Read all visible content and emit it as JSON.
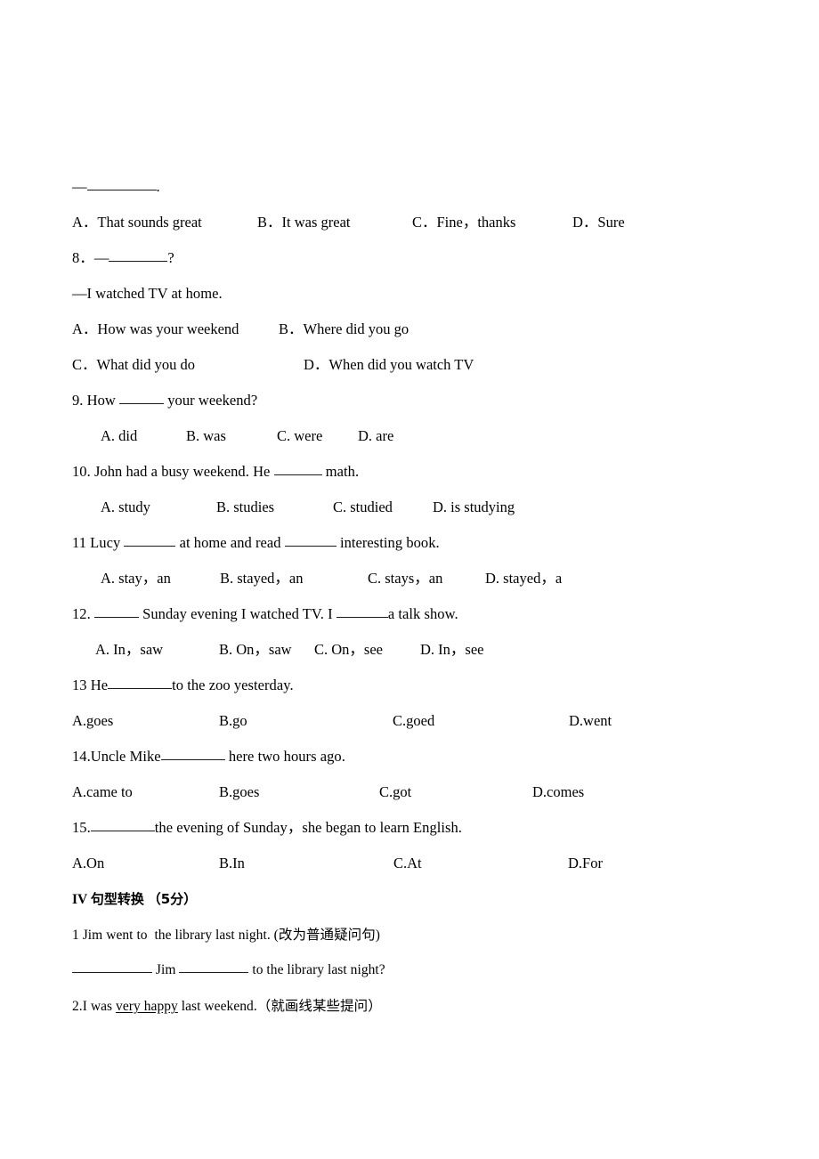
{
  "document": {
    "type": "exam-paper",
    "language": "English / Chinese",
    "page_background": "#ffffff",
    "text_color": "#000000"
  },
  "content": {
    "q7_answer_stem": {
      "dash": "—",
      "trailing": "."
    },
    "q7_options": {
      "a": "A．That sounds great",
      "b": "B．It was great",
      "c": "C．Fine，thanks",
      "d": "D．Sure"
    },
    "q8": {
      "number": "8．",
      "dash": "—",
      "trailing": "?",
      "reply": "—I watched TV at home.",
      "a": "A．How was your weekend",
      "b": "B．Where did you go",
      "c": "C．What did you do",
      "d": "D．When did you watch TV"
    },
    "q9": {
      "stem_before": "9. How ",
      "stem_after": " your weekend?",
      "a": "A. did",
      "b": "B. was",
      "c": "C. were",
      "d": "D. are"
    },
    "q10": {
      "stem_before": "10. John had a busy weekend. He ",
      "stem_after": " math.",
      "a": "A. study",
      "b": "B. studies",
      "c": "C. studied",
      "d": "D. is studying"
    },
    "q11": {
      "stem_before": "11 Lucy ",
      "stem_middle": " at home and read ",
      "stem_after": " interesting book.",
      "a": "A. stay，an",
      "b": "B. stayed，an",
      "c": "C. stays，an",
      "d": "D. stayed，a"
    },
    "q12": {
      "stem_before": "12. ",
      "stem_middle": " Sunday evening I watched TV. I ",
      "stem_after": "a talk show.",
      "a": "A. In，saw",
      "b": "B. On，saw",
      "c": "C. On，see",
      "d": "D. In，see"
    },
    "q13": {
      "stem_before": "13 He",
      "stem_after": "to the zoo yesterday.",
      "a": "A.goes",
      "b": "B.go",
      "c": "C.goed",
      "d": "D.went"
    },
    "q14": {
      "stem_before": "14.Uncle Mike",
      "stem_after": " here two hours ago.",
      "a": "A.came to",
      "b": "B.goes",
      "c": "C.got",
      "d": "D.comes"
    },
    "q15": {
      "stem_before": "15.",
      "stem_after": "the evening of Sunday，she began to learn English.",
      "a": "A.On",
      "b": "B.In",
      "c": "C.At",
      "d": "D.For"
    },
    "section4": {
      "numeral": "IV",
      "title": "句型转换",
      "score": "（5分）"
    },
    "t1": {
      "sentence": "1 Jim went to  the library last night. (",
      "instruction": "改为普通疑问句",
      "close": ")",
      "answer_mid": " Jim ",
      "answer_end": " to the library last night?"
    },
    "t2": {
      "before": "2.I was ",
      "underlined": "very happy",
      "after": " last weekend.（",
      "instruction": "就画线某些提问",
      "close": "）"
    }
  }
}
